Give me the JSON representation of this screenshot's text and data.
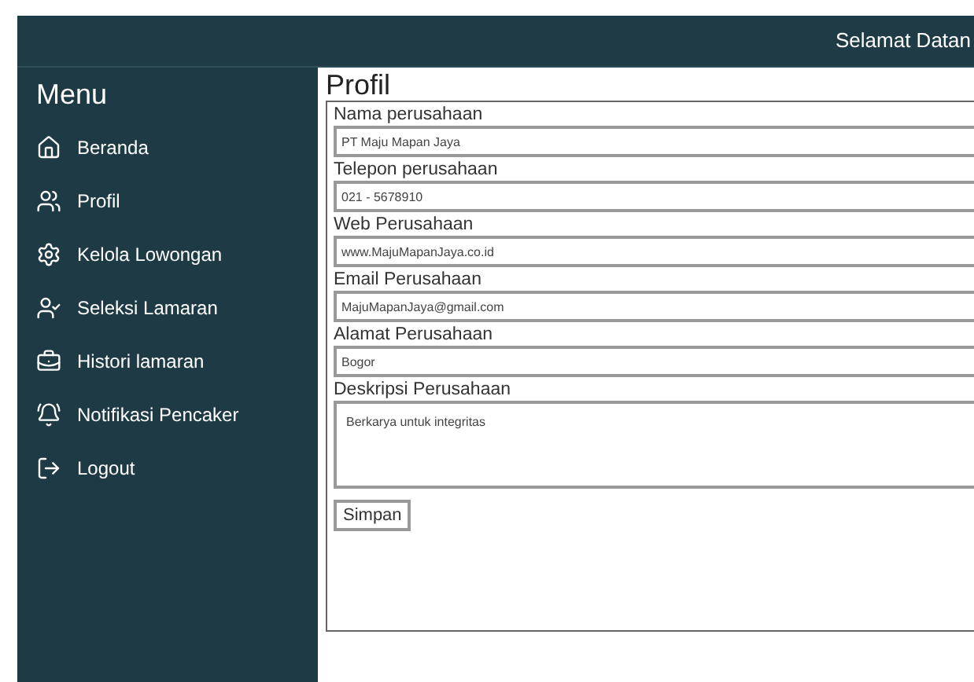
{
  "header": {
    "greeting": "Selamat Datan"
  },
  "sidebar": {
    "title": "Menu",
    "items": [
      {
        "label": "Beranda"
      },
      {
        "label": "Profil"
      },
      {
        "label": "Kelola Lowongan"
      },
      {
        "label": "Seleksi Lamaran"
      },
      {
        "label": "Histori lamaran"
      },
      {
        "label": "Notifikasi Pencaker"
      },
      {
        "label": "Logout"
      }
    ]
  },
  "main": {
    "title": "Profil",
    "fields": [
      {
        "kind": "input",
        "label": "Nama perusahaan",
        "value": "PT Maju Mapan Jaya"
      },
      {
        "kind": "input",
        "label": "Telepon perusahaan",
        "value": "021 - 5678910"
      },
      {
        "kind": "input",
        "label": "Web Perusahaan",
        "value": "www.MajuMapanJaya.co.id"
      },
      {
        "kind": "input",
        "label": "Email Perusahaan",
        "value": "MajuMapanJaya@gmail.com"
      },
      {
        "kind": "input",
        "label": "Alamat Perusahaan",
        "value": "Bogor"
      },
      {
        "kind": "textarea",
        "label": "Deskripsi Perusahaan",
        "value": "Berkarya untuk integritas"
      }
    ],
    "save_button": "Simpan"
  }
}
